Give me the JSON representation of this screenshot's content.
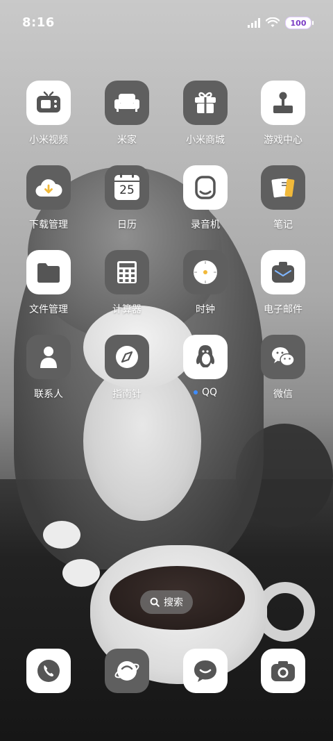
{
  "status_bar": {
    "time": "8:16",
    "battery_level": "100",
    "icons": [
      "signal-icon",
      "wifi-icon",
      "battery-icon"
    ]
  },
  "apps": [
    {
      "label": "小米视频",
      "icon": "tv-icon",
      "theme": "light"
    },
    {
      "label": "米家",
      "icon": "sofa-icon",
      "theme": "dark"
    },
    {
      "label": "小米商城",
      "icon": "gift-icon",
      "theme": "dark"
    },
    {
      "label": "游戏中心",
      "icon": "joystick-icon",
      "theme": "light"
    },
    {
      "label": "下载管理",
      "icon": "cloud-download-icon",
      "theme": "dark"
    },
    {
      "label": "日历",
      "icon": "calendar-icon",
      "theme": "dark",
      "badge_text": "25"
    },
    {
      "label": "录音机",
      "icon": "recorder-icon",
      "theme": "light"
    },
    {
      "label": "笔记",
      "icon": "notes-icon",
      "theme": "dark"
    },
    {
      "label": "文件管理",
      "icon": "folder-icon",
      "theme": "light"
    },
    {
      "label": "计算器",
      "icon": "calculator-icon",
      "theme": "dark"
    },
    {
      "label": "时钟",
      "icon": "clock-icon",
      "theme": "dark"
    },
    {
      "label": "电子邮件",
      "icon": "mail-icon",
      "theme": "light"
    },
    {
      "label": "联系人",
      "icon": "contact-icon",
      "theme": "dark"
    },
    {
      "label": "指南针",
      "icon": "compass-icon",
      "theme": "dark"
    },
    {
      "label": "QQ",
      "icon": "penguin-icon",
      "theme": "light",
      "new_dot": true
    },
    {
      "label": "微信",
      "icon": "wechat-icon",
      "theme": "dark"
    }
  ],
  "search": {
    "label": "搜索"
  },
  "dock": [
    {
      "icon": "phone-icon"
    },
    {
      "icon": "browser-icon"
    },
    {
      "icon": "messages-icon"
    },
    {
      "icon": "camera-icon"
    }
  ],
  "colors": {
    "icon_light": "#ffffff",
    "icon_dark": "#5f5f5f",
    "glyph_dark": "#555555",
    "accent_blue": "#3d8cff",
    "battery_purple": "#7b3cc5"
  }
}
